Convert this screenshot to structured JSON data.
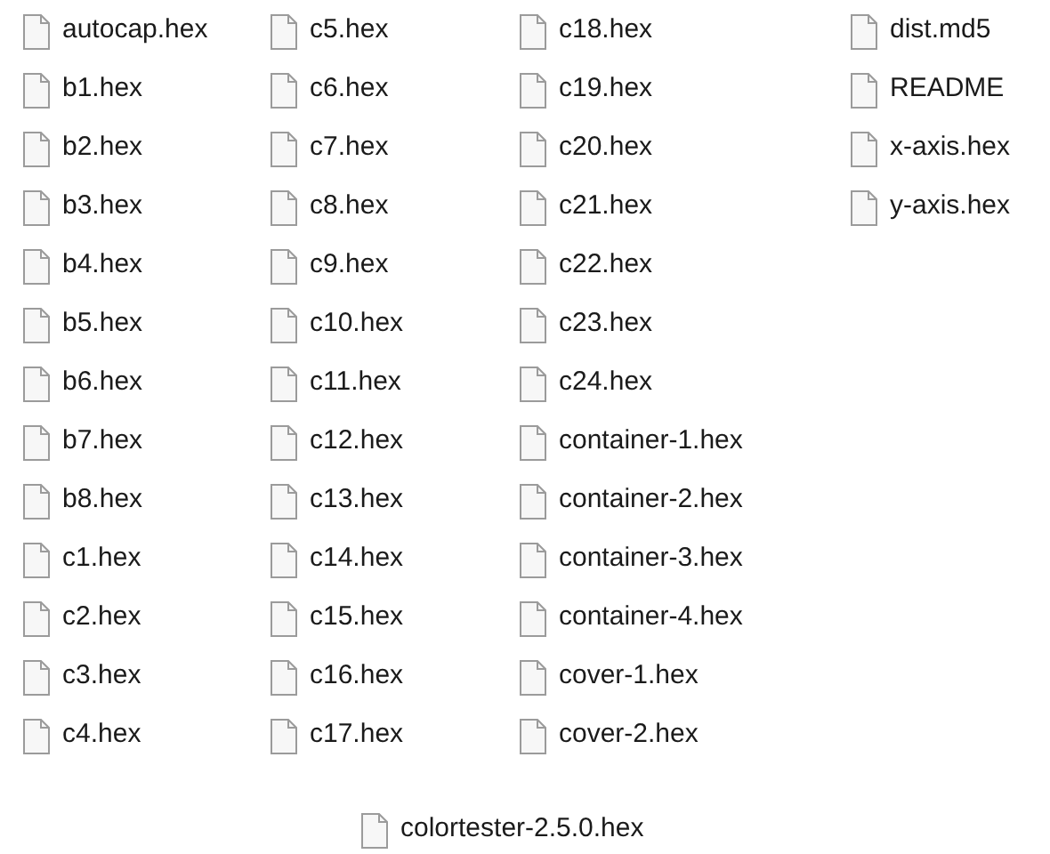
{
  "columns": [
    {
      "files": [
        "autocap.hex",
        "b1.hex",
        "b2.hex",
        "b3.hex",
        "b4.hex",
        "b5.hex",
        "b6.hex",
        "b7.hex",
        "b8.hex",
        "c1.hex",
        "c2.hex",
        "c3.hex",
        "c4.hex"
      ]
    },
    {
      "files": [
        "c5.hex",
        "c6.hex",
        "c7.hex",
        "c8.hex",
        "c9.hex",
        "c10.hex",
        "c11.hex",
        "c12.hex",
        "c13.hex",
        "c14.hex",
        "c15.hex",
        "c16.hex",
        "c17.hex"
      ]
    },
    {
      "files": [
        "c18.hex",
        "c19.hex",
        "c20.hex",
        "c21.hex",
        "c22.hex",
        "c23.hex",
        "c24.hex",
        "container-1.hex",
        "container-2.hex",
        "container-3.hex",
        "container-4.hex",
        "cover-1.hex",
        "cover-2.hex"
      ]
    },
    {
      "files": [
        "dist.md5",
        "README",
        "x-axis.hex",
        "y-axis.hex"
      ]
    }
  ],
  "bottom_file": "colortester-2.5.0.hex"
}
